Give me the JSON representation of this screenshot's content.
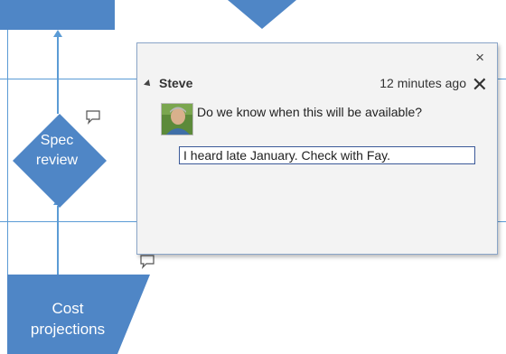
{
  "diagram": {
    "spec_review": "Spec\nreview",
    "cost_projections": "Cost\nprojections"
  },
  "comment_pane": {
    "close_glyph": "×",
    "author": "Steve",
    "time": "12 minutes ago",
    "delete_glyph": "✕",
    "comment_text": "Do we know when this will be available?",
    "reply_text": "I heard late January. Check with Fay."
  },
  "colors": {
    "shape_fill": "#4f86c6",
    "connector": "#5b9bd5",
    "pane_background": "#f3f3f3"
  }
}
